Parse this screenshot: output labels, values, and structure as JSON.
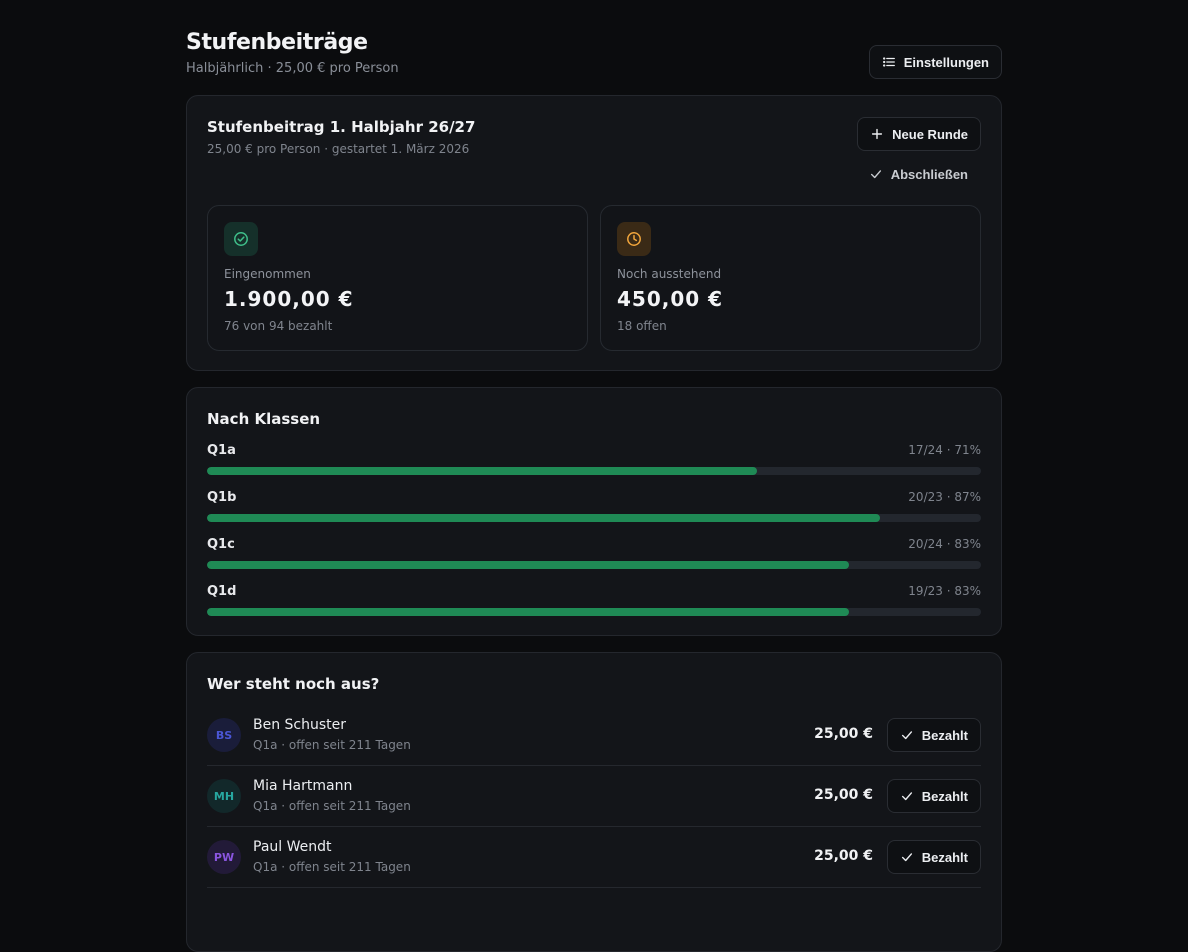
{
  "header": {
    "title": "Stufenbeiträge",
    "subtitle": "Halbjährlich · 25,00 € pro Person",
    "settings_label": "Einstellungen"
  },
  "round": {
    "title": "Stufenbeitrag 1. Halbjahr 26/27",
    "subtitle": "25,00 € pro Person · gestartet 1. März 2026",
    "new_round_label": "Neue Runde",
    "close_label": "Abschließen"
  },
  "stats": {
    "collected": {
      "label": "Eingenommen",
      "value": "1.900,00 €",
      "note": "76 von 94 bezahlt",
      "icon": "check-circle-icon",
      "color": "#3fbf8a"
    },
    "outstanding": {
      "label": "Noch ausstehend",
      "value": "450,00 €",
      "note": "18 offen",
      "icon": "clock-icon",
      "color": "#f0a53c"
    }
  },
  "classes": {
    "title": "Nach Klassen",
    "items": [
      {
        "name": "Q1a",
        "info": "17/24 · 71%",
        "progress": 0.71
      },
      {
        "name": "Q1b",
        "info": "20/23 · 87%",
        "progress": 0.87
      },
      {
        "name": "Q1c",
        "info": "20/24 · 83%",
        "progress": 0.83
      },
      {
        "name": "Q1d",
        "info": "19/23 · 83%",
        "progress": 0.83
      }
    ]
  },
  "outstanding": {
    "title": "Wer steht noch aus?",
    "items": [
      {
        "initials": "BS",
        "name": "Ben Schuster",
        "meta": "Q1a · offen seit 211 Tagen",
        "amount": "25,00 €",
        "button": "Bezahlt",
        "color": "#4a56d6",
        "bg": "#1a1d3a"
      },
      {
        "initials": "MH",
        "name": "Mia Hartmann",
        "meta": "Q1a · offen seit 211 Tagen",
        "amount": "25,00 €",
        "button": "Bezahlt",
        "color": "#27a7a0",
        "bg": "#12282a"
      },
      {
        "initials": "PW",
        "name": "Paul Wendt",
        "meta": "Q1a · offen seit 211 Tagen",
        "amount": "25,00 €",
        "button": "Bezahlt",
        "color": "#8a55e0",
        "bg": "#221a38"
      }
    ]
  }
}
